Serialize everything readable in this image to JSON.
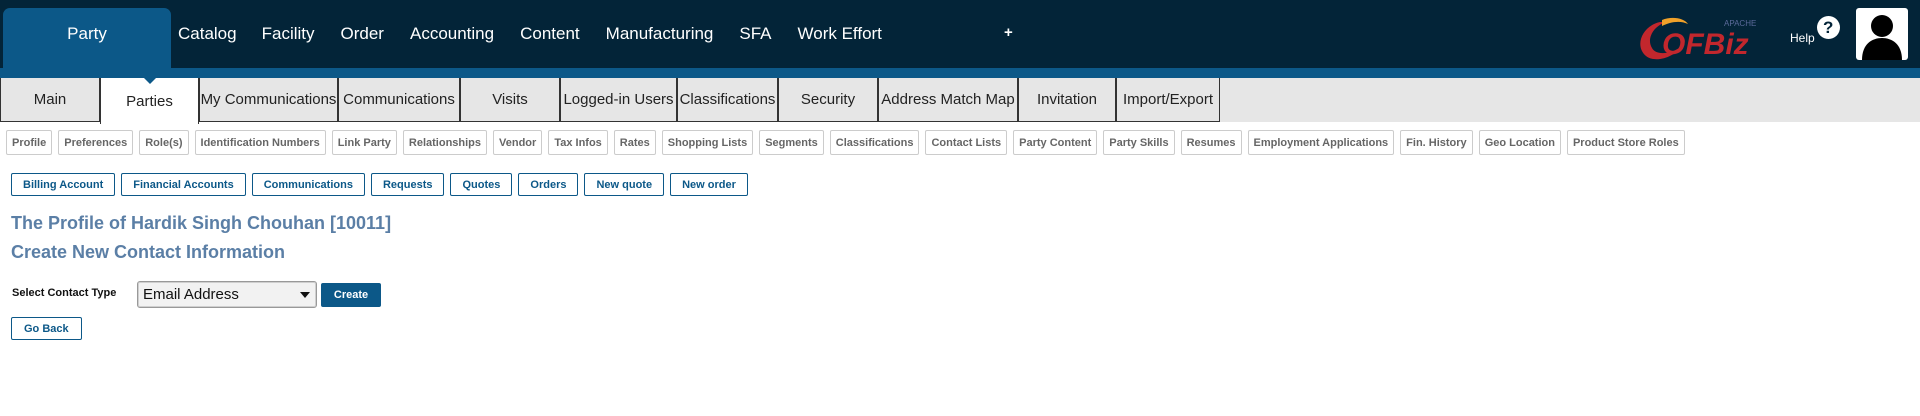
{
  "app_tab": "Party",
  "top_nav": [
    "Catalog",
    "Facility",
    "Order",
    "Accounting",
    "Content",
    "Manufacturing",
    "SFA",
    "Work Effort"
  ],
  "top_nav_plus": "+",
  "logo": {
    "small_text": "APACHE",
    "text": "OFBiz"
  },
  "help": {
    "label": "Help",
    "icon_glyph": "?"
  },
  "tabs": [
    "Main",
    "Parties",
    "My Communications",
    "Communications",
    "Visits",
    "Logged-in Users",
    "Classifications",
    "Security",
    "Address Match Map",
    "Invitation",
    "Import/Export"
  ],
  "active_tab": "Parties",
  "sub_links": [
    "Profile",
    "Preferences",
    "Role(s)",
    "Identification Numbers",
    "Link Party",
    "Relationships",
    "Vendor",
    "Tax Infos",
    "Rates",
    "Shopping Lists",
    "Segments",
    "Classifications",
    "Contact Lists",
    "Party Content",
    "Party Skills",
    "Resumes",
    "Employment Applications",
    "Fin. History",
    "Geo Location",
    "Product Store Roles"
  ],
  "actions": [
    "Billing Account",
    "Financial Accounts",
    "Communications",
    "Requests",
    "Quotes",
    "Orders",
    "New quote",
    "New order"
  ],
  "profile_title": "The Profile of Hardik Singh Chouhan [10011]",
  "page_title": "Create New Contact Information",
  "form": {
    "label": "Select Contact Type",
    "selected": "Email Address",
    "create_label": "Create"
  },
  "go_back": "Go Back",
  "colors": {
    "header_bg": "#032438",
    "accent": "#0c5888",
    "title": "#5b7fa6",
    "tab_bar_bg": "#e6e6e6"
  }
}
